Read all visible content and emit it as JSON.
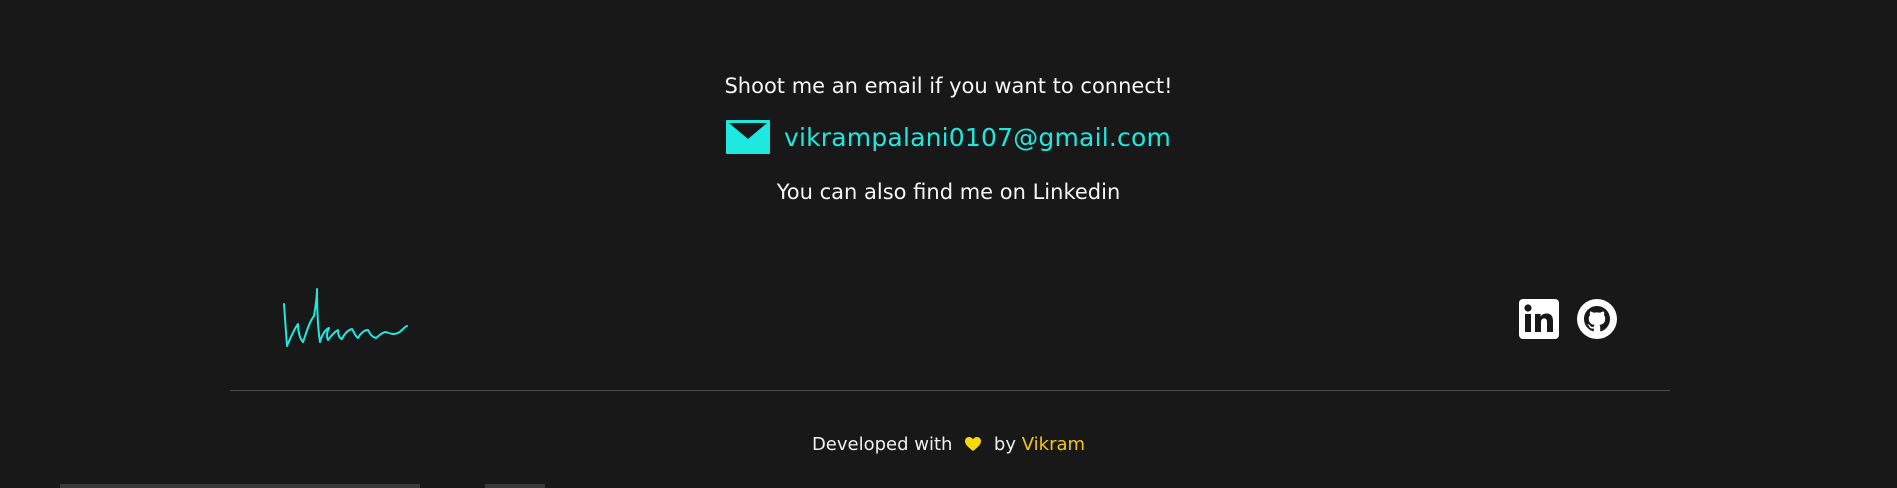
{
  "contact": {
    "intro": "Shoot me an email if you want to connect!",
    "email": "vikrampalani0107@gmail.com",
    "linkedin_note": "You can also find me on Linkedin"
  },
  "signature": {
    "icon": "signature-icon",
    "color": "#1de9e0"
  },
  "socials": [
    {
      "name": "LinkedIn",
      "icon": "linkedin-icon"
    },
    {
      "name": "GitHub",
      "icon": "github-icon"
    }
  ],
  "footer": {
    "prefix": "Developed with",
    "by": "by",
    "author": "Vikram",
    "heart_color": "#f5d90a",
    "author_color": "#f5c518"
  },
  "colors": {
    "background": "#181818",
    "accent": "#1de9e0",
    "text": "#f5f5f5"
  }
}
